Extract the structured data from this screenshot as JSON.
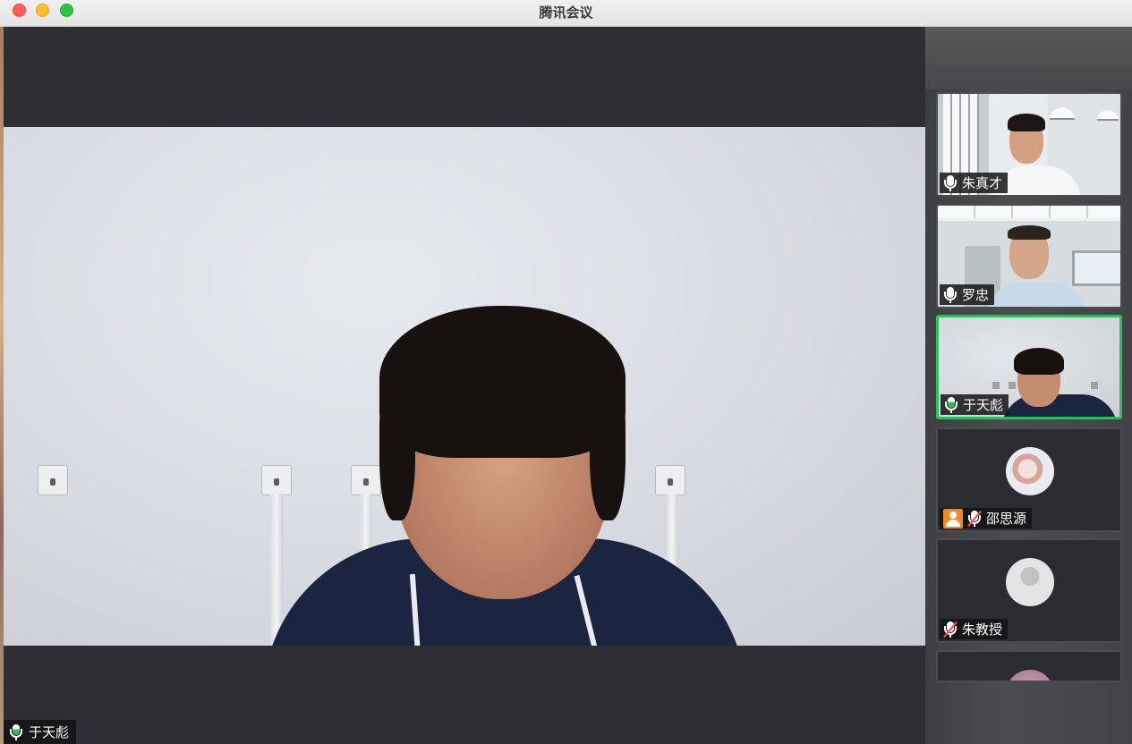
{
  "window": {
    "title": "腾讯会议"
  },
  "main_video": {
    "speaker_name": "于天彪",
    "mic_state": "speaking"
  },
  "participants": [
    {
      "name": "朱真才",
      "mic_state": "on",
      "video": "camera"
    },
    {
      "name": "罗忠",
      "mic_state": "on",
      "video": "camera"
    },
    {
      "name": "于天彪",
      "mic_state": "speaking",
      "video": "camera",
      "active": true
    },
    {
      "name": "邵思源",
      "mic_state": "muted",
      "video": "avatar",
      "badge": "share-icon"
    },
    {
      "name": "朱教授",
      "mic_state": "muted",
      "video": "avatar"
    },
    {
      "name": "",
      "mic_state": "",
      "video": "avatar"
    }
  ],
  "colors": {
    "active_border": "#2fbc5a",
    "muted_icon": "#ff4d4f",
    "badge": "#f08a24"
  }
}
